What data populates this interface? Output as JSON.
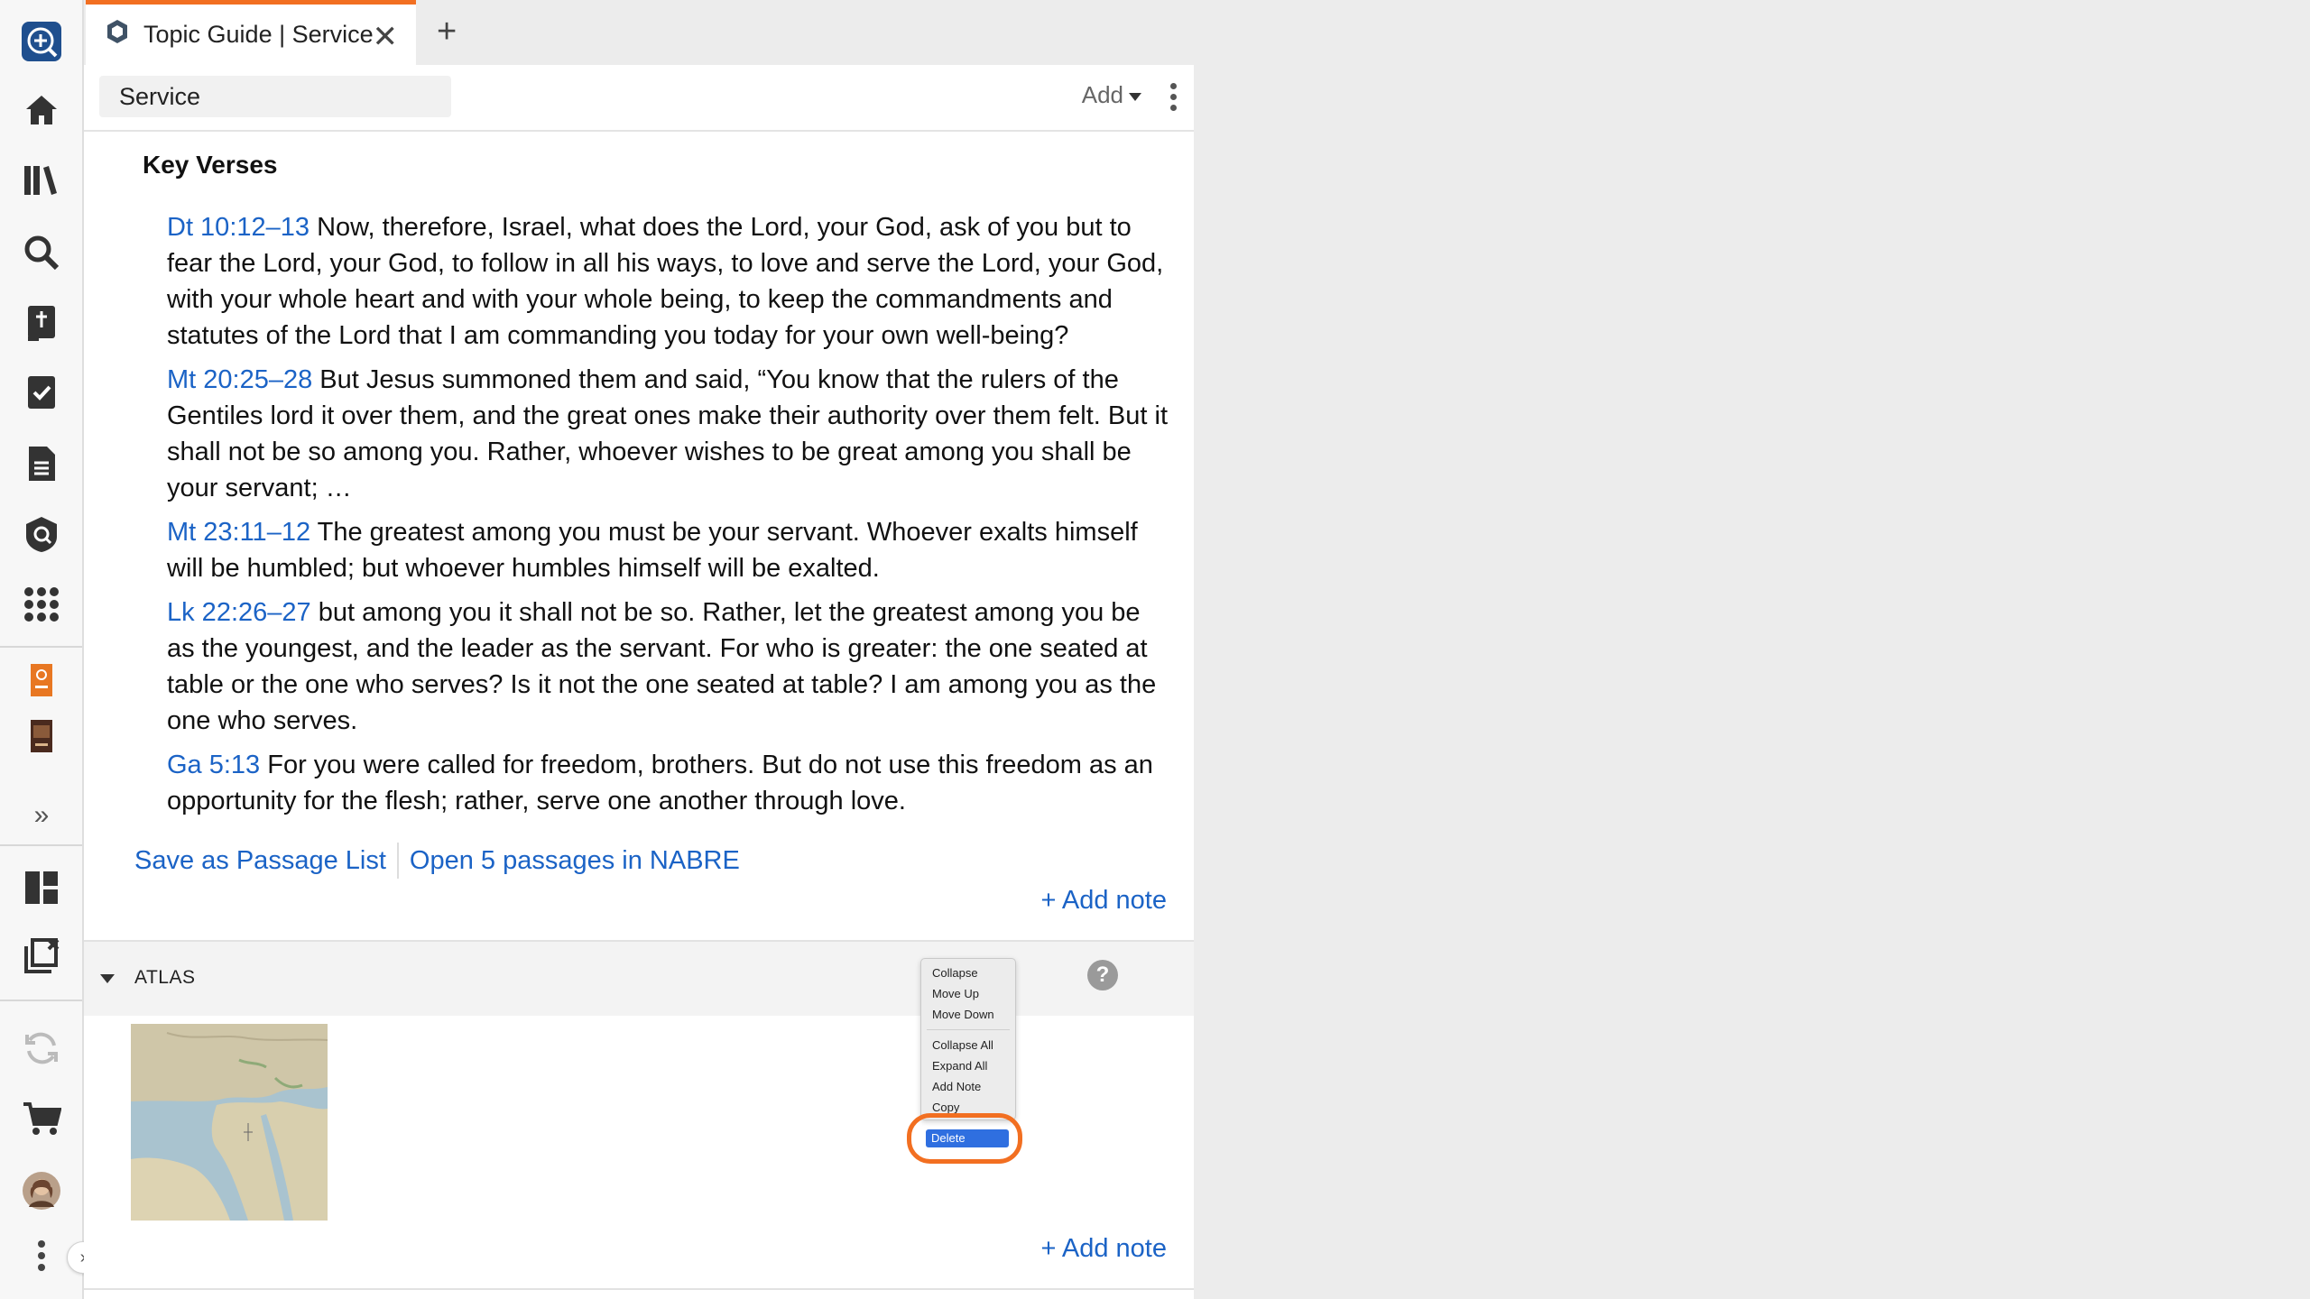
{
  "tab": {
    "title": "Topic Guide | Service",
    "close": "✕",
    "new_tab": "+"
  },
  "toolbar": {
    "title_value": "Service",
    "add_label": "Add"
  },
  "key_verses": {
    "heading": "Key Verses",
    "items": [
      {
        "ref": "Dt 10:12–13",
        "text": " Now, therefore, Israel, what does the Lord, your God, ask of you but to fear the Lord, your God, to follow in all his ways, to love and serve the Lord, your God, with your whole heart and with your whole being, to keep the commandments and statutes of the Lord that I am commanding you today for your own well-being?"
      },
      {
        "ref": "Mt 20:25–28",
        "text": " But Jesus summoned them and said, “You know that the rulers of the Gentiles lord it over them, and the great ones make their authority over them felt. But it shall not be so among you. Rather, whoever wishes to be great among you shall be your servant; …"
      },
      {
        "ref": "Mt 23:11–12",
        "text": " The greatest among you must be your servant. Whoever exalts himself will be humbled; but whoever humbles himself will be exalted."
      },
      {
        "ref": "Lk 22:26–27",
        "text": " but among you it shall not be so. Rather, let the greatest among you be as the youngest, and the leader as the servant. For who is greater: the one seated at table or the one who serves? Is it not the one seated at table? I am among you as the one who serves."
      },
      {
        "ref": "Ga 5:13",
        "text": "  For you were called for freedom, brothers. But do not use this freedom as an opportunity for the flesh; rather, serve one another through love."
      }
    ],
    "save_link": "Save as Passage List",
    "open_link": "Open 5 passages in NABRE",
    "add_note": "+ Add note"
  },
  "atlas": {
    "label": "ATLAS",
    "help": "?",
    "add_note": "+ Add note"
  },
  "context_menu": {
    "items": [
      "Collapse",
      "Move Up",
      "Move Down",
      "Collapse All",
      "Expand All",
      "Add Note",
      "Copy"
    ],
    "delete": "Delete"
  },
  "colors": {
    "accent": "#f26f21",
    "link": "#1b63c6",
    "menu_highlight": "#2f6fe0"
  },
  "sidebar_icons": [
    "logos-add-icon",
    "home-icon",
    "library-icon",
    "search-icon",
    "bible-add-icon",
    "reading-plan-icon",
    "document-icon",
    "guide-icon",
    "apps-icon",
    "resource-icon",
    "book-icon",
    "expand-icon",
    "layouts-icon",
    "close-panels-icon",
    "sync-icon",
    "cart-icon",
    "avatar",
    "more-icon"
  ]
}
